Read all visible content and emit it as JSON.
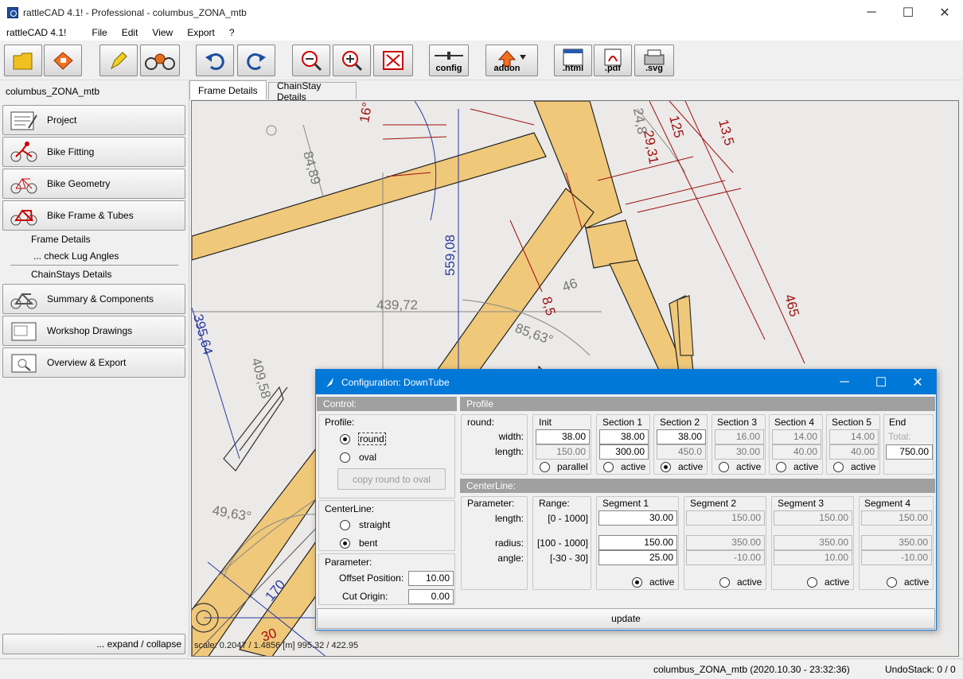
{
  "window": {
    "title": "rattleCAD 4.1! - Professional  - columbus_ZONA_mtb",
    "minimize": "─",
    "maximize": "☐",
    "close": "✕"
  },
  "menu": {
    "app": "rattleCAD 4.1!",
    "items": [
      "File",
      "Edit",
      "View",
      "Export",
      "?"
    ]
  },
  "toolbar": {
    "config_label": "config",
    "addon_label": "addon",
    "html_label": ".html",
    "pdf_label": ".pdf",
    "svg_label": ".svg"
  },
  "sidebar": {
    "project_name": "columbus_ZONA_mtb",
    "items": [
      {
        "label": "Project"
      },
      {
        "label": "Bike Fitting"
      },
      {
        "label": "Bike Geometry"
      },
      {
        "label": "Bike Frame & Tubes"
      }
    ],
    "subitems": [
      "Frame Details",
      "... check Lug Angles",
      "ChainStays Details"
    ],
    "items2": [
      {
        "label": "Summary & Components"
      },
      {
        "label": "Workshop Drawings"
      },
      {
        "label": "Overview & Export"
      }
    ],
    "expand": "... expand / collapse"
  },
  "tabs": [
    "Frame Details",
    "ChainStay Details"
  ],
  "drawing": {
    "dims": [
      "84,89",
      "16°",
      "559,08",
      "439,72",
      "46",
      "85,63°",
      "8,5",
      "125",
      "13,5",
      "465",
      "24,8",
      "29,31",
      "409,58",
      "49,63°",
      "170",
      "30",
      "395,64"
    ]
  },
  "scale_text": "scale: 0.2047 / 1.4856  [m]  995.32 / 422.95",
  "status": {
    "file": "columbus_ZONA_mtb (2020.10.30 - 23:32:36)",
    "undo": "UndoStack:  0 /  0"
  },
  "dialog": {
    "title": "Configuration: DownTube",
    "control_header": "Control:",
    "profile_header": "Profile",
    "profile_group": "Profile:",
    "profile_round": "round",
    "profile_oval": "oval",
    "copy_button": "copy round to oval",
    "centerline_group": "CenterLine:",
    "cl_straight": "straight",
    "cl_bent": "bent",
    "parameter_group": "Parameter:",
    "offset_label": "Offset Position:",
    "offset_value": "10.00",
    "cut_label": "Cut Origin:",
    "cut_value": "0.00",
    "prof": {
      "round_label": "round:",
      "width_label": "width:",
      "length_label": "length:",
      "init": {
        "title": "Init",
        "width": "38.00",
        "length": "150.00",
        "radio": "parallel"
      },
      "sections": [
        {
          "title": "Section 1",
          "width": "38.00",
          "length": "300.00",
          "radio": "active"
        },
        {
          "title": "Section 2",
          "width": "38.00",
          "length": "450.0",
          "radio": "active"
        },
        {
          "title": "Section 3",
          "width": "16.00",
          "length": "30.00",
          "radio": "active"
        },
        {
          "title": "Section 4",
          "width": "14.00",
          "length": "40.00",
          "radio": "active"
        },
        {
          "title": "Section 5",
          "width": "14.00",
          "length": "40.00",
          "radio": "active"
        }
      ],
      "end": {
        "title": "End",
        "total_label": "Total:",
        "total": "750.00"
      }
    },
    "centerline_header": "CenterLine:",
    "cl": {
      "param_label": "Parameter:",
      "range_label": "Range:",
      "length_label": "length:",
      "radius_label": "radius:",
      "angle_label": "angle:",
      "range_length": "[0 - 1000]",
      "range_radius": "[100 - 1000]",
      "range_angle": "[-30  -  30]",
      "segments": [
        {
          "title": "Segment 1",
          "length": "30.00",
          "radius": "150.00",
          "angle": "25.00",
          "radio": "active"
        },
        {
          "title": "Segment 2",
          "length": "150.00",
          "radius": "350.00",
          "angle": "-10.00",
          "radio": "active"
        },
        {
          "title": "Segment 3",
          "length": "150.00",
          "radius": "350.00",
          "angle": "10.00",
          "radio": "active"
        },
        {
          "title": "Segment 4",
          "length": "150.00",
          "radius": "350.00",
          "angle": "-10.00",
          "radio": "active"
        }
      ]
    },
    "update": "update"
  }
}
